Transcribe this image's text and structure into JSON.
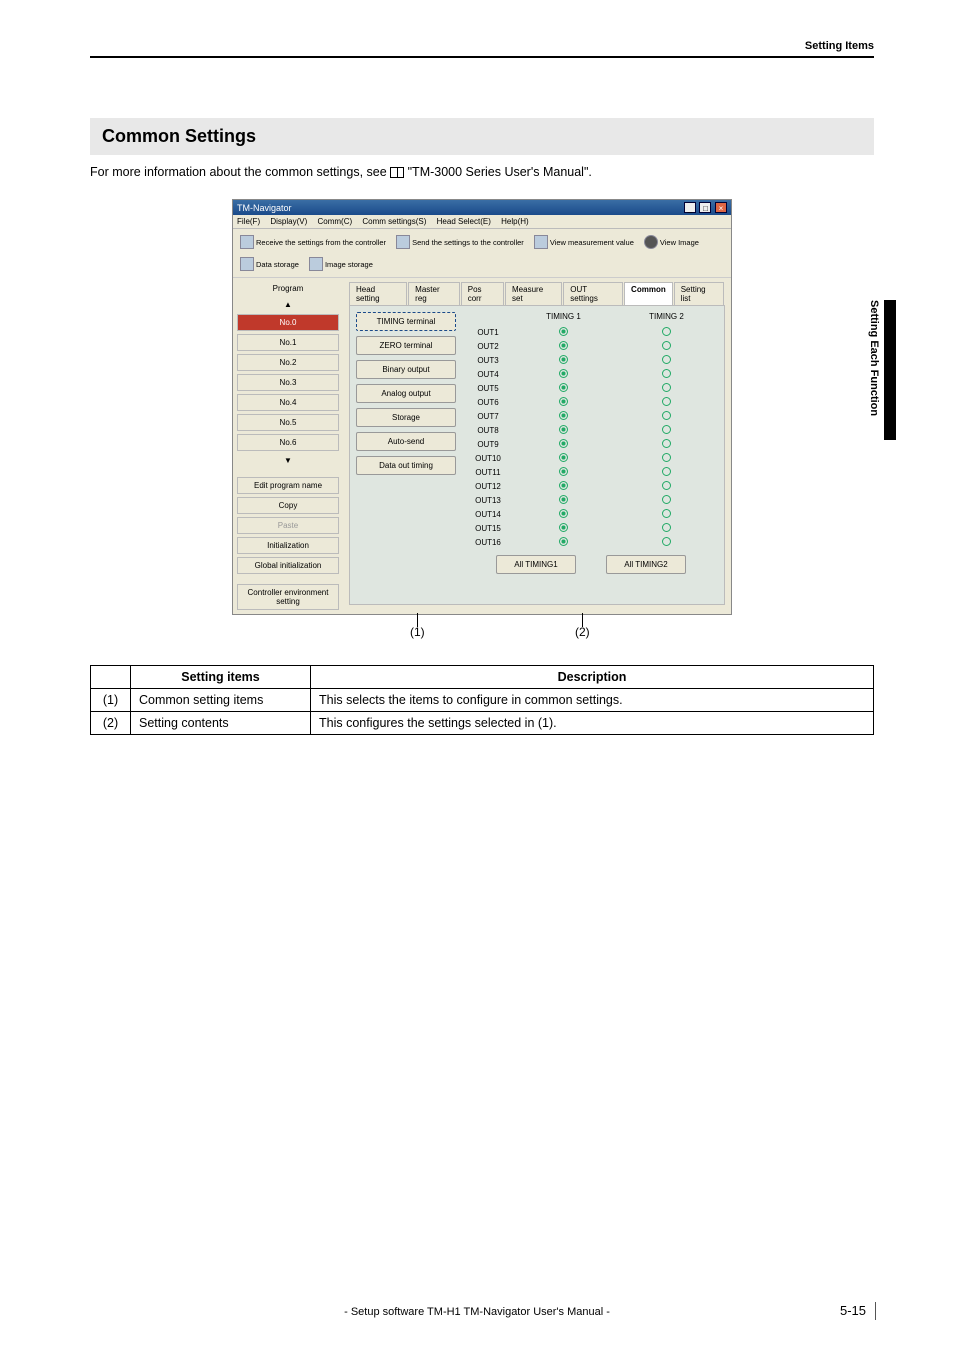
{
  "header": {
    "right_label": "Setting Items"
  },
  "section": {
    "title": "Common Settings"
  },
  "intro": {
    "text_before": "For more information about the common settings, see ",
    "text_after": " \"TM-3000 Series User's Manual\"."
  },
  "side_tab": "Setting Each Function",
  "window": {
    "title": "TM-Navigator",
    "menu": [
      "File(F)",
      "Display(V)",
      "Comm(C)",
      "Comm settings(S)",
      "Head Select(E)",
      "Help(H)"
    ],
    "toolbar": [
      "Receive the settings from the controller",
      "Send the settings to the controller",
      "View measurement value",
      "View Image",
      "Data storage",
      "Image storage"
    ],
    "left": {
      "label_program": "Program",
      "programs": [
        "No.0",
        "No.1",
        "No.2",
        "No.3",
        "No.4",
        "No.5",
        "No.6"
      ],
      "active_index": 0,
      "edit_program_name": "Edit program name",
      "copy": "Copy",
      "paste": "Paste",
      "initialization": "Initialization",
      "global_init": "Global initialization",
      "controller_env": "Controller environment setting"
    },
    "tabs": [
      "Head setting",
      "Master reg",
      "Pos corr",
      "Measure set",
      "OUT settings",
      "Common",
      "Setting list"
    ],
    "active_tab": 5,
    "common_buttons": [
      "TIMING terminal",
      "ZERO terminal",
      "Binary output",
      "Analog output",
      "Storage",
      "Auto-send",
      "Data out timing"
    ],
    "selected_common_button": 0,
    "radio_header": {
      "col1": "TIMING 1",
      "col2": "TIMING 2"
    },
    "outs": [
      "OUT1",
      "OUT2",
      "OUT3",
      "OUT4",
      "OUT5",
      "OUT6",
      "OUT7",
      "OUT8",
      "OUT9",
      "OUT10",
      "OUT11",
      "OUT12",
      "OUT13",
      "OUT14",
      "OUT15",
      "OUT16"
    ],
    "out_selection": [
      1,
      1,
      1,
      1,
      1,
      1,
      1,
      1,
      1,
      1,
      1,
      1,
      1,
      1,
      1,
      1
    ],
    "bottom_buttons": [
      "All TIMING1",
      "All TIMING2"
    ]
  },
  "callouts": {
    "c1": "(1)",
    "c2": "(2)"
  },
  "table": {
    "head": {
      "items": "Setting items",
      "desc": "Description"
    },
    "rows": [
      {
        "num": "(1)",
        "items": "Common setting items",
        "desc": "This selects the items to configure in common settings."
      },
      {
        "num": "(2)",
        "items": "Setting contents",
        "desc": "This configures the settings selected in (1)."
      }
    ]
  },
  "footer": {
    "center": "- Setup software TM-H1 TM-Navigator User's Manual -",
    "page": "5-15"
  },
  "chart_data": {
    "type": "table",
    "title": "TIMING terminal assignment",
    "columns": [
      "OUT",
      "TIMING 1",
      "TIMING 2"
    ],
    "rows": [
      [
        "OUT1",
        1,
        0
      ],
      [
        "OUT2",
        1,
        0
      ],
      [
        "OUT3",
        1,
        0
      ],
      [
        "OUT4",
        1,
        0
      ],
      [
        "OUT5",
        1,
        0
      ],
      [
        "OUT6",
        1,
        0
      ],
      [
        "OUT7",
        1,
        0
      ],
      [
        "OUT8",
        1,
        0
      ],
      [
        "OUT9",
        1,
        0
      ],
      [
        "OUT10",
        1,
        0
      ],
      [
        "OUT11",
        1,
        0
      ],
      [
        "OUT12",
        1,
        0
      ],
      [
        "OUT13",
        1,
        0
      ],
      [
        "OUT14",
        1,
        0
      ],
      [
        "OUT15",
        1,
        0
      ],
      [
        "OUT16",
        1,
        0
      ]
    ]
  }
}
